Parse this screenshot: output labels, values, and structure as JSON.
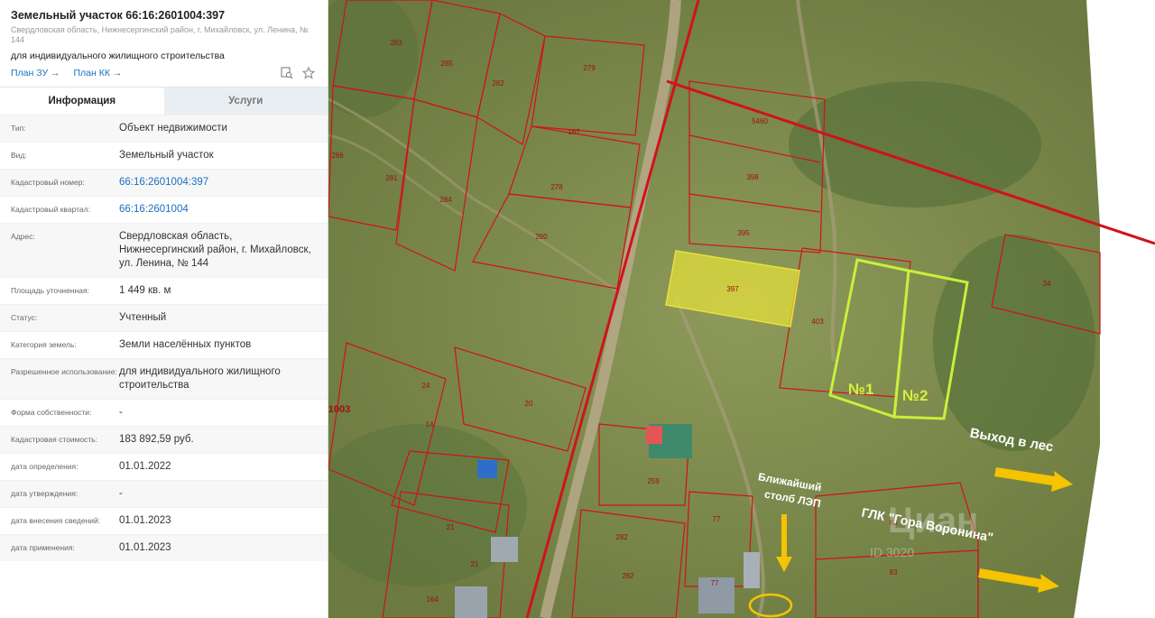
{
  "header": {
    "title": "Земельный участок 66:16:2601004:397",
    "address_small": "Свердловская область, Нижнесергинский район, г. Михайловск, ул. Ленина, № 144",
    "usage": "для индивидуального жилищного строительства",
    "link_plan_zu": "План ЗУ →",
    "link_plan_kk": "План КК →",
    "icons": [
      "object-search-icon",
      "star-icon"
    ]
  },
  "tabs": [
    {
      "label": "Информация",
      "active": true
    },
    {
      "label": "Услуги",
      "active": false
    }
  ],
  "rows": [
    {
      "label": "Тип:",
      "value": "Объект недвижимости"
    },
    {
      "label": "Вид:",
      "value": "Земельный участок"
    },
    {
      "label": "Кадастровый номер:",
      "value": "66:16:2601004:397"
    },
    {
      "label": "Кадастровый квартал:",
      "value": "66:16:2601004"
    },
    {
      "label": "Адрес:",
      "value": "Свердловская область, Нижнесергинский район, г. Михайловск, ул. Ленина, № 144"
    },
    {
      "label": "Площадь уточненная:",
      "value": "1 449 кв. м"
    },
    {
      "label": "Статус:",
      "value": "Учтенный"
    },
    {
      "label": "Категория земель:",
      "value": "Земли населённых пунктов"
    },
    {
      "label": "Разрешенное использование:",
      "value": "для индивидуального жилищного строительства"
    },
    {
      "label": "Форма собственности:",
      "value": "-"
    },
    {
      "label": "Кадастровая стоимость:",
      "value": "183 892,59 руб."
    },
    {
      "label": "дата определения:",
      "value": "01.01.2022"
    },
    {
      "label": "дата утверждения:",
      "value": "-"
    },
    {
      "label": "дата внесения сведений:",
      "value": "01.01.2023"
    },
    {
      "label": "дата применения:",
      "value": "01.01.2023"
    }
  ],
  "map": {
    "parcel_labels": [
      "283",
      "285",
      "282",
      "279",
      "286",
      "281",
      "167",
      "284",
      "278",
      "280",
      "5460",
      "398",
      "395",
      "397",
      "403",
      "34",
      "24",
      "20",
      "14",
      "1003",
      "259",
      "77",
      "282",
      "282",
      "21",
      "21",
      "164",
      "77",
      "83",
      "83"
    ],
    "annotations": {
      "plot1": "№1",
      "plot2": "№2",
      "forest_exit": "Выход в лес",
      "power_pole_line1": "Ближайший",
      "power_pole_line2": "столб ЛЭП",
      "glk": "ГЛК \"Гора Воронина\"",
      "watermark": "Циан",
      "watermark_id": "ID 3020"
    },
    "colors": {
      "border": "#d0121b",
      "highlight": "#e8e23a",
      "plot": "#c8f03a",
      "arrow": "#f5c400",
      "grass": "#7d8a4e"
    }
  }
}
